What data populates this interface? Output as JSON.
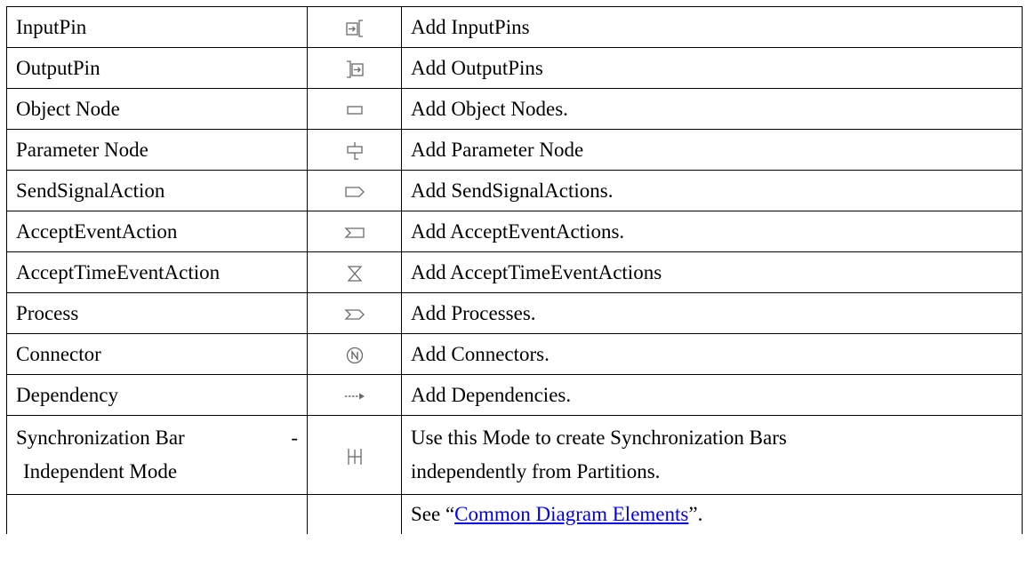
{
  "rows": [
    {
      "name": "InputPin",
      "icon": "input-pin-icon",
      "description": "Add InputPins"
    },
    {
      "name": "OutputPin",
      "icon": "output-pin-icon",
      "description": "Add OutputPins"
    },
    {
      "name": "Object Node",
      "icon": "object-node-icon",
      "description": "Add Object Nodes."
    },
    {
      "name": "Parameter Node",
      "icon": "parameter-node-icon",
      "description": "Add Parameter Node"
    },
    {
      "name": "SendSignalAction",
      "icon": "send-signal-action-icon",
      "description": "Add SendSignalActions."
    },
    {
      "name": "AcceptEventAction",
      "icon": "accept-event-action-icon",
      "description": "Add AcceptEventActions."
    },
    {
      "name": "AcceptTimeEventAction",
      "icon": "accept-time-event-action-icon",
      "description": "Add AcceptTimeEventActions"
    },
    {
      "name": "Process",
      "icon": "process-icon",
      "description": "Add Processes."
    },
    {
      "name": "Connector",
      "icon": "connector-icon",
      "description": "Add Connectors."
    },
    {
      "name": "Dependency",
      "icon": "dependency-icon",
      "description": "Add Dependencies."
    }
  ],
  "sync_row": {
    "name_line1": "Synchronization Bar",
    "name_sep": "-",
    "name_line2": "Independent Mode",
    "icon": "synchronization-bar-icon",
    "description_line1": "Use this Mode to create Synchronization Bars",
    "description_line2": "independently from Partitions."
  },
  "footer_row": {
    "prefix": "See “",
    "link_text": "Common Diagram Elements",
    "suffix": "”.",
    "link_color": "#0000ee"
  }
}
